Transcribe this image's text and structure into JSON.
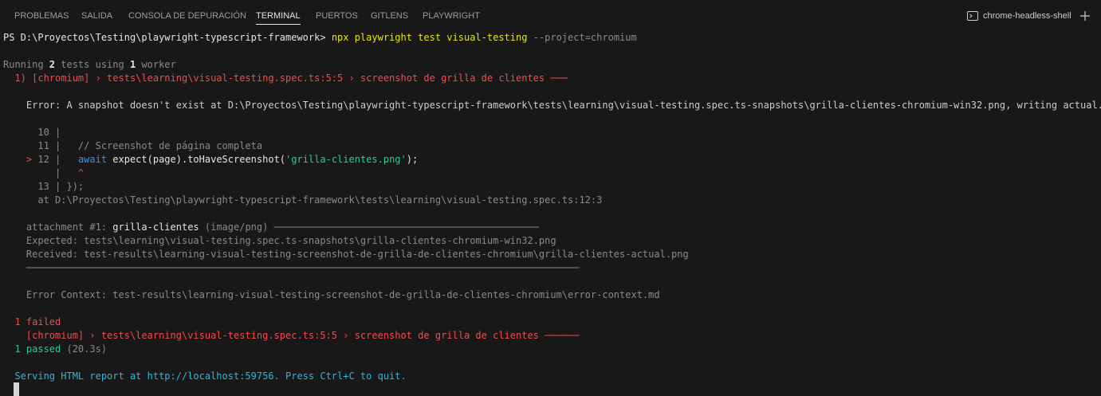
{
  "panel_tabs": [
    {
      "label": "PROBLEMAS"
    },
    {
      "label": "SALIDA"
    },
    {
      "label": "CONSOLA DE DEPURACIÓN"
    },
    {
      "label": "TERMINAL"
    },
    {
      "label": "PUERTOS"
    },
    {
      "label": "GITLENS"
    },
    {
      "label": "PLAYWRIGHT"
    }
  ],
  "active_tab": "TERMINAL",
  "terminal_instance": {
    "name": "chrome-headless-shell",
    "icon": "terminal-icon",
    "add_icon": "plus-icon"
  },
  "colors": {
    "background": "#181818",
    "error_red": "#f14c4c",
    "pass_green": "#23d18b",
    "command_yellow": "#e5e510",
    "link_blue": "#3b8eea",
    "dim": "#8a8a8a"
  },
  "terminal": {
    "prompt": {
      "text": "PS D:\\Proyectos\\Testing\\playwright-typescript-framework> ",
      "command": "npx playwright test visual-testing",
      "args": " --project=chromium"
    },
    "running": {
      "prefix": "Running ",
      "tests": "2",
      "mid": " tests using ",
      "workers": "1",
      "suffix": " worker"
    },
    "failure_header": "  1) [chromium] › tests\\learning\\visual-testing.spec.ts:5:5 › screenshot de grilla de clientes ───",
    "error_message": "    Error: A snapshot doesn't exist at D:\\Proyectos\\Testing\\playwright-typescript-framework\\tests\\learning\\visual-testing.spec.ts-snapshots\\grilla-clientes-chromium-win32.png, writing actual.",
    "code": {
      "line10": "      10 |",
      "line11": "      11 |   // Screenshot de página completa",
      "line12_marker": "    > ",
      "line12_num": "12 |   ",
      "line12_await": "await",
      "line12_call": " expect(page).toHaveScreenshot(",
      "line12_str": "'grilla-clientes.png'",
      "line12_end": ");",
      "caret_gutter": "         |   ",
      "caret": "^",
      "line13": "      13 | });"
    },
    "at_line": "      at D:\\Proyectos\\Testing\\playwright-typescript-framework\\tests\\learning\\visual-testing.spec.ts:12:3",
    "attachment": {
      "prefix": "    attachment #1: ",
      "name": "grilla-clientes",
      "suffix": " (image/png) ──────────────────────────────────────────────",
      "expected": "    Expected: tests\\learning\\visual-testing.spec.ts-snapshots\\grilla-clientes-chromium-win32.png",
      "received": "    Received: test-results\\learning-visual-testing-screenshot-de-grilla-de-clientes-chromium\\grilla-clientes-actual.png",
      "rule": "    ────────────────────────────────────────────────────────────────────────────────────────────────"
    },
    "error_context": "    Error Context: test-results\\learning-visual-testing-screenshot-de-grilla-de-clientes-chromium\\error-context.md",
    "summary": {
      "failed": "  1 failed",
      "failed_test": "    [chromium] › tests\\learning\\visual-testing.spec.ts:5:5 › screenshot de grilla de clientes ──────",
      "passed": "  1 passed",
      "duration": " (20.3s)"
    },
    "report": "  Serving HTML report at http://localhost:59756. Press Ctrl+C to quit."
  }
}
